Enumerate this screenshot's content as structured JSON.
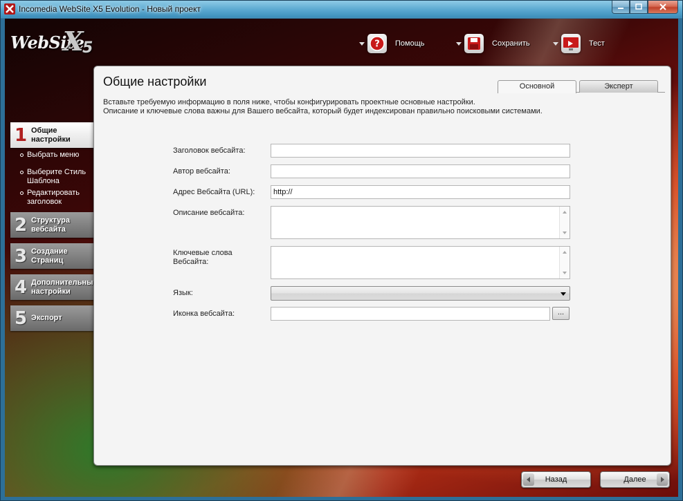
{
  "window": {
    "title": "Incomedia WebSite X5 Evolution - Новый проект",
    "minimize_icon": "minimize-icon",
    "maximize_icon": "maximize-icon",
    "close_icon": "close-icon"
  },
  "brand": {
    "text": "WebSite",
    "x_mark": "X",
    "version_mark": "5"
  },
  "toolbar": {
    "help_label": "Помощь",
    "save_label": "Сохранить",
    "test_label": "Тест"
  },
  "sidebar": {
    "steps": [
      {
        "num": "1",
        "label": "Общие\nнастройки"
      },
      {
        "num": "2",
        "label": "Структура\nвебсайта"
      },
      {
        "num": "3",
        "label": "Создание\nСтраниц"
      },
      {
        "num": "4",
        "label": "Дополнительные\nнастройки"
      },
      {
        "num": "5",
        "label": "Экспорт"
      }
    ],
    "substeps": [
      {
        "label": "Выбрать меню"
      },
      {
        "label": "Выберите Стиль\nШаблона"
      },
      {
        "label": "Редактировать\nзаголовок"
      }
    ]
  },
  "panel": {
    "title": "Общие настройки",
    "tabs": [
      {
        "label": "Основной"
      },
      {
        "label": "Эксперт"
      }
    ],
    "description_line1": "Вставьте требуемую информацию в поля ниже, чтобы конфигурировать проектные основные настройки.",
    "description_line2": "Описание и ключевые слова важны для Вашего вебсайта, который будет индексирован правильно поисковыми системами."
  },
  "form": {
    "site_title": {
      "label": "Заголовок вебсайта:",
      "value": ""
    },
    "site_author": {
      "label": "Автор вебсайта:",
      "value": ""
    },
    "site_url": {
      "label": "Адрес Вебсайта (URL):",
      "value": "http://"
    },
    "site_description": {
      "label": "Описание вебсайта:",
      "value": ""
    },
    "site_keywords": {
      "label": "Ключевые слова\nВебсайта:",
      "value": ""
    },
    "language": {
      "label": "Язык:",
      "value": ""
    },
    "site_icon": {
      "label": "Иконка вебсайта:",
      "value": "",
      "browse_label": "..."
    }
  },
  "nav": {
    "back_label": "Назад",
    "next_label": "Далее"
  }
}
